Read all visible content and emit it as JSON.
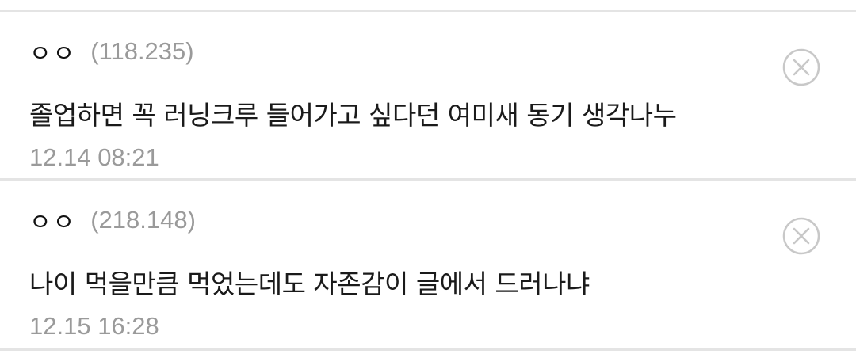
{
  "comments": [
    {
      "author": "ㅇㅇ",
      "ip": "(118.235)",
      "text": "졸업하면 꼭 러닝크루 들어가고 싶다던 여미새 동기 생각나누",
      "time": "12.14 08:21",
      "delete_icon": "close-circle-icon"
    },
    {
      "author": "ㅇㅇ",
      "ip": "(218.148)",
      "text": "나이 먹을만큼 먹었는데도 자존감이 글에서 드러나냐",
      "time": "12.15 16:28",
      "delete_icon": "close-circle-icon"
    }
  ],
  "colors": {
    "divider": "#e4e4e4",
    "meta_text": "#9a9a9a",
    "body_text": "#1a1a1a",
    "icon": "#c8c8c8"
  }
}
